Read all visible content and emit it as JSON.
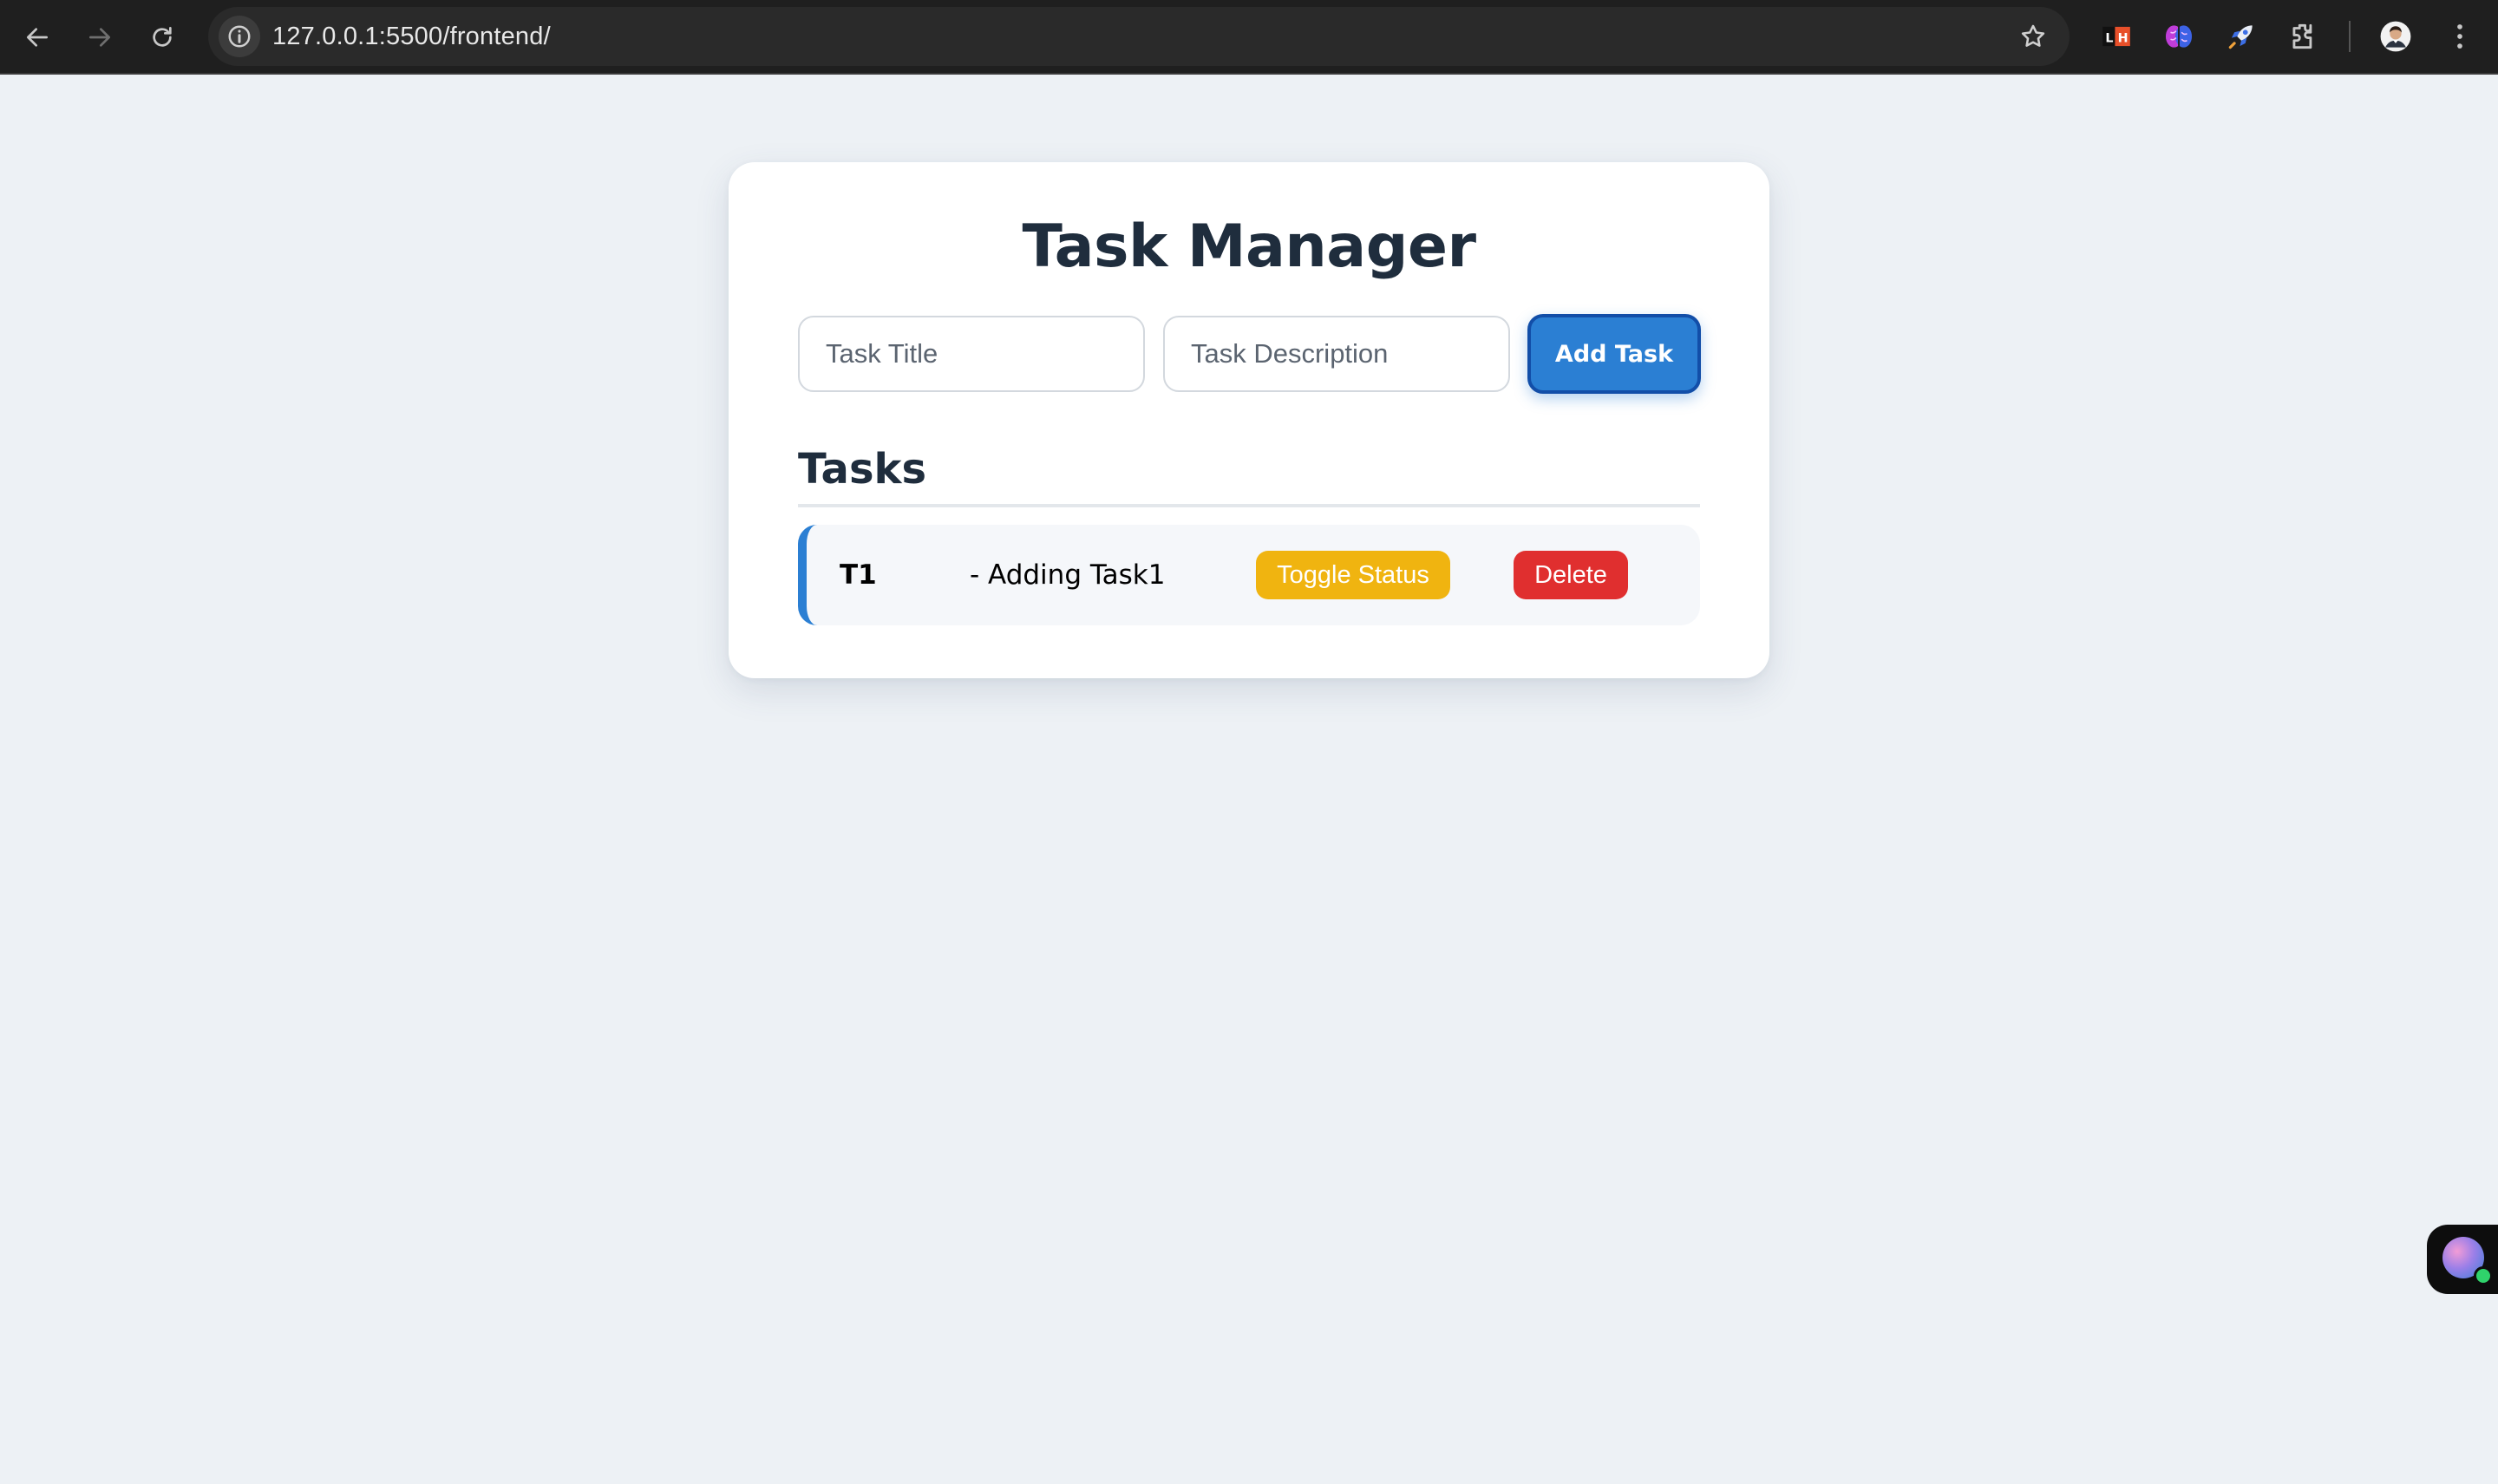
{
  "browser": {
    "url": "127.0.0.1:5500/frontend/",
    "extensions": [
      {
        "name": "lighthouse-extension-icon",
        "label": "LH"
      },
      {
        "name": "brain-extension-icon"
      },
      {
        "name": "rocket-extension-icon"
      },
      {
        "name": "puzzle-extensions-icon"
      }
    ]
  },
  "app": {
    "title": "Task Manager",
    "form": {
      "title_placeholder": "Task Title",
      "description_placeholder": "Task Description",
      "add_label": "Add Task"
    },
    "tasks_heading": "Tasks",
    "tasks": [
      {
        "title": "T1",
        "description": "- Adding Task1",
        "toggle_label": "Toggle Status",
        "delete_label": "Delete"
      }
    ]
  },
  "colors": {
    "accent": "#2b7fd3",
    "toggle": "#f0b410",
    "delete": "#e02f2f",
    "background": "#edf1f5"
  }
}
